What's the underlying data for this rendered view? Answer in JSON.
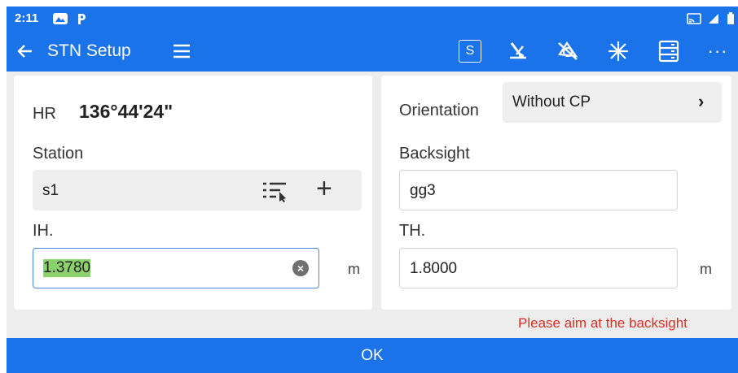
{
  "status_bar": {
    "time": "2:11",
    "icons": [
      "gallery-icon",
      "parking-app-icon",
      "screen-cast-icon",
      "signal-icon",
      "battery-icon"
    ]
  },
  "app_bar": {
    "title": "STN Setup",
    "back_icon": "arrow-left-icon",
    "menu_icon": "hamburger-menu-icon",
    "s_badge_label": "S",
    "action_icons": [
      "laser-off-icon",
      "compensator-off-icon",
      "laser-pointer-icon",
      "list-settings-icon",
      "more-icon"
    ],
    "more_label": "···",
    "color": "#1a73e8"
  },
  "left_panel": {
    "hr_label": "HR",
    "hr_value": "136°44'24\"",
    "station_label": "Station",
    "station_value": "s1",
    "station_list_icon": "select-from-list-icon",
    "station_add_label": "+",
    "ih_label": "IH.",
    "ih_value": "1.3780",
    "ih_unit": "m",
    "ih_clear_label": "×"
  },
  "right_panel": {
    "orientation_label": "Orientation",
    "orientation_value": "Without CP",
    "orientation_chevron": "›",
    "backsight_label": "Backsight",
    "backsight_value": "gg3",
    "th_label": "TH.",
    "th_value": "1.8000",
    "th_unit": "m"
  },
  "hint": "Please aim at the backsight",
  "ok_label": "OK",
  "colors": {
    "accent": "#1a73e8",
    "warning": "#d93025",
    "selection_highlight": "#8bd16c"
  }
}
